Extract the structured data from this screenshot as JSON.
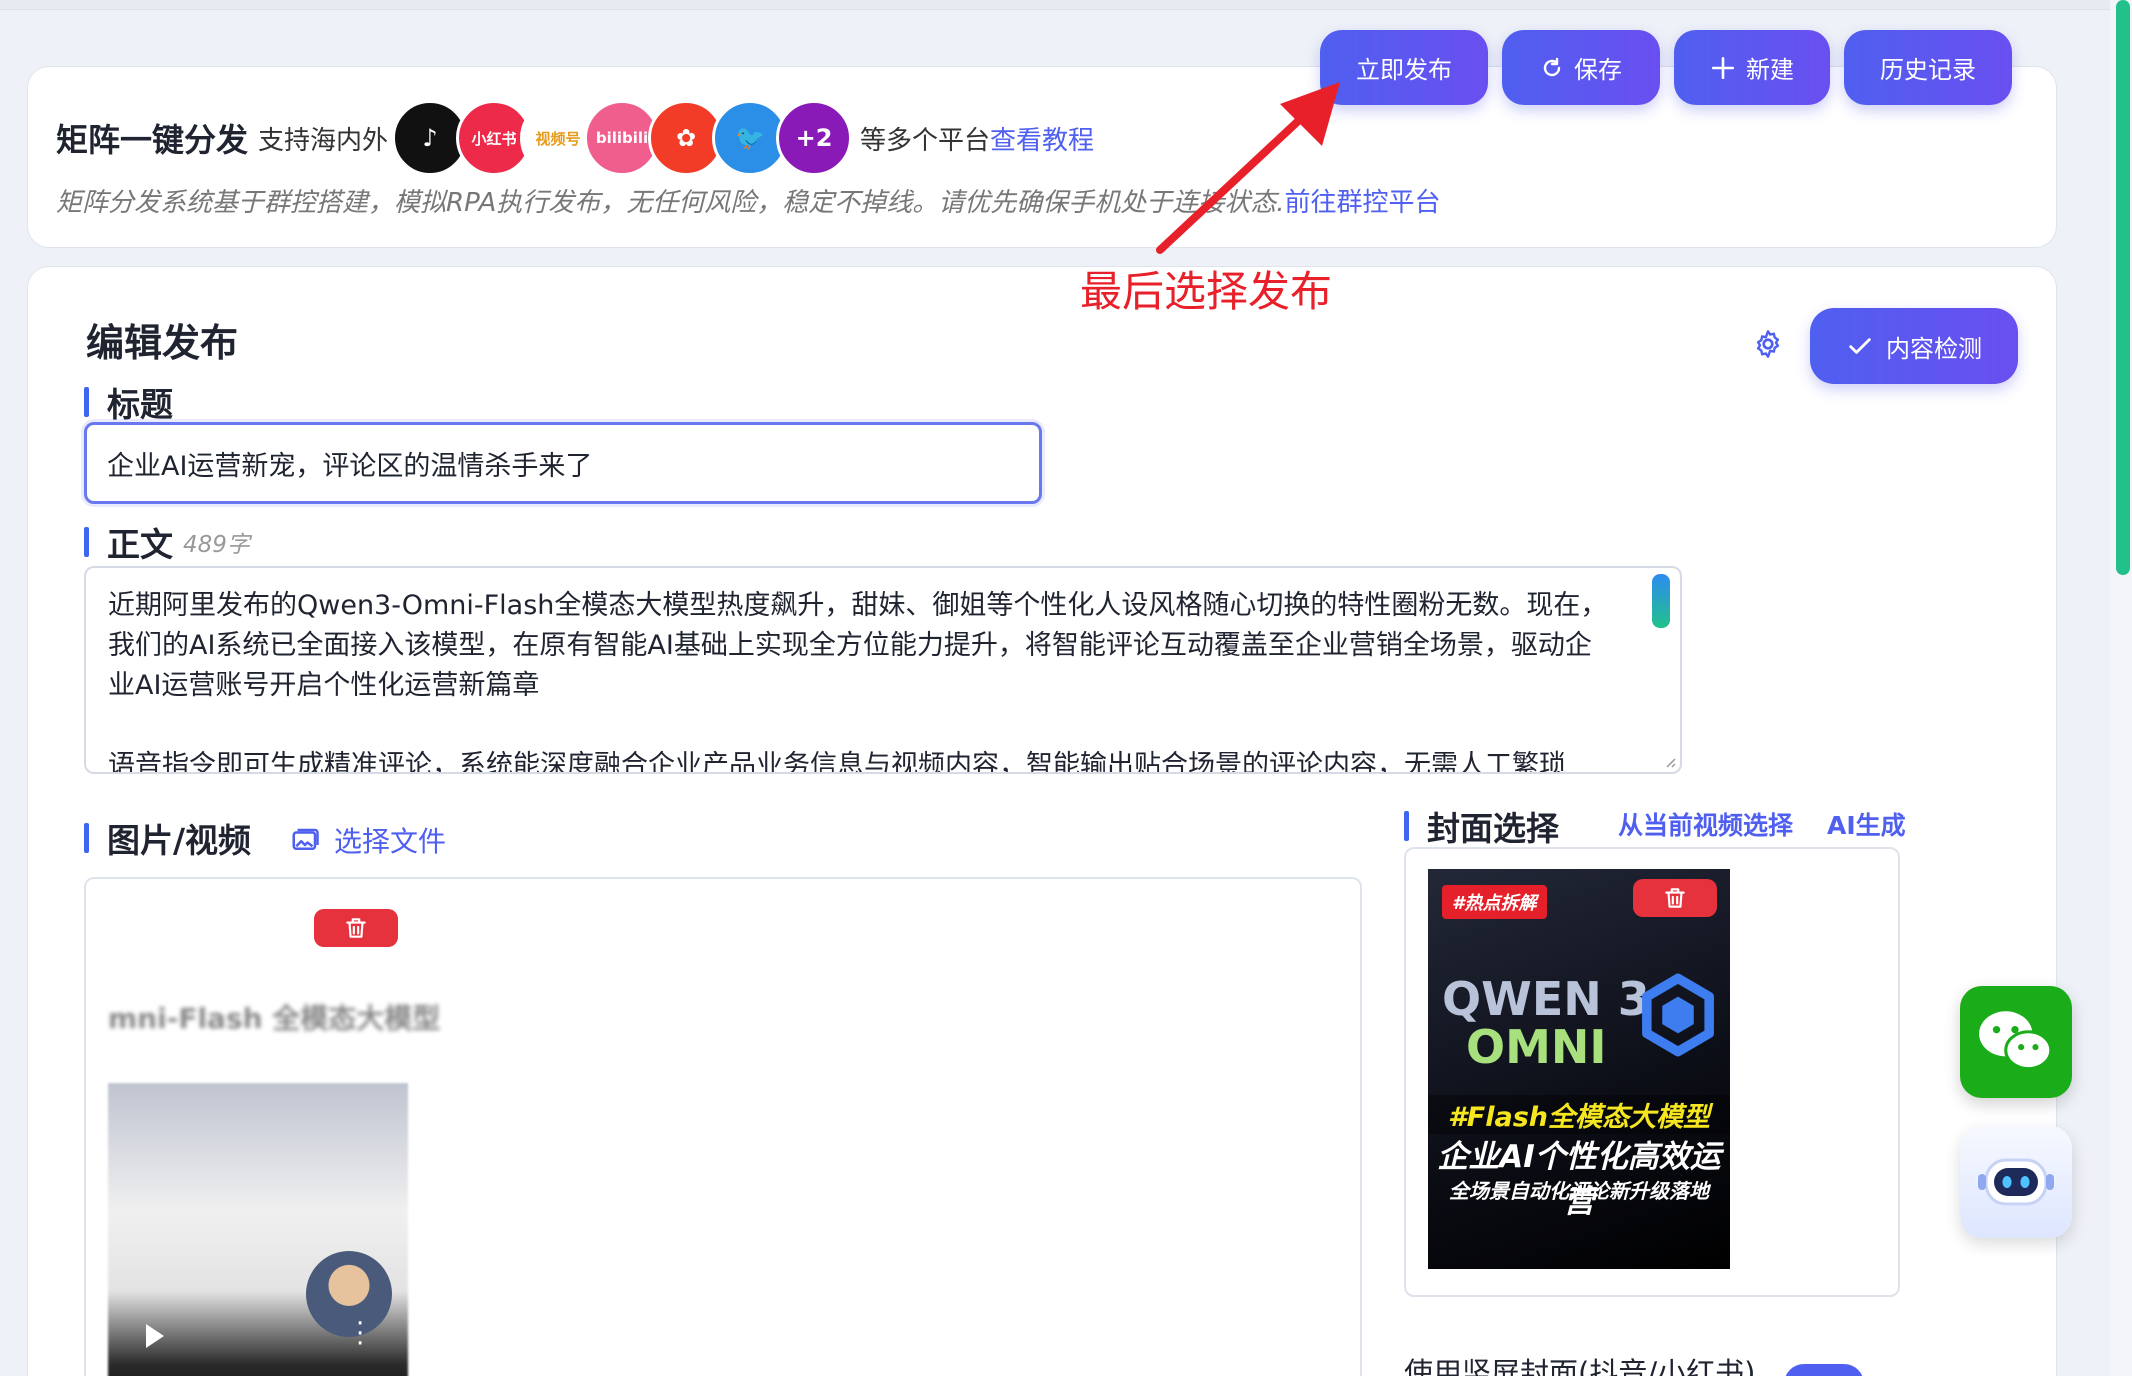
{
  "toolbar": {
    "publish": "立即发布",
    "save": "保存",
    "new": "新建",
    "history": "历史记录"
  },
  "matrix": {
    "title": "矩阵一键分发",
    "subtitle": "支持海内外",
    "platforms": [
      {
        "label": "♪",
        "color": "#111111",
        "icon": "douyin-icon"
      },
      {
        "label": "小红书",
        "color": "#ee2a4a",
        "icon": "xiaohongshu-icon"
      },
      {
        "label": "视频号",
        "color": "#ffffff",
        "icon": "shipinhao-icon"
      },
      {
        "label": "bilibili",
        "color": "#ef5e8d",
        "icon": "bilibili-icon"
      },
      {
        "label": "✿",
        "color": "#f23c28",
        "icon": "kuaishou-icon"
      },
      {
        "label": "🐦",
        "color": "#2b8fe8",
        "icon": "twitter-icon"
      },
      {
        "label": "+2",
        "color": "#8a1ab8",
        "icon": "more-platforms-icon"
      }
    ],
    "more_text": "等多个平台",
    "tutorial_link": "查看教程",
    "description": "矩阵分发系统基于群控搭建，模拟RPA执行发布，无任何风险，稳定不掉线。请优先确保手机处于连接状态.",
    "group_control_link": "前往群控平台"
  },
  "annotation": {
    "text": "最后选择发布"
  },
  "editor": {
    "heading": "编辑发布",
    "check_button": "内容检测",
    "title_label": "标题",
    "title_value": "企业AI运营新宠，评论区的温情杀手来了",
    "body_label": "正文",
    "word_count": "489字",
    "body_text": "近期阿里发布的Qwen3-Omni-Flash全模态大模型热度飙升，甜妹、御姐等个性化人设风格随心切换的特性圈粉无数。现在，我们的AI系统已全面接入该模型，在原有智能AI基础上实现全方位能力提升，将智能评论互动覆盖至企业营销全场景，驱动企业AI运营账号开启个性化运营新篇章\n\n语音指令即可生成精准评论，系统能深度融合企业产品业务信息与视频内容，智能输出贴合场景的评论内容，无需人工繁琐"
  },
  "media": {
    "label": "图片/视频",
    "choose_file": "选择文件",
    "thumb_title": "mni-Flash 全模态大模型"
  },
  "cover": {
    "label": "封面选择",
    "from_video": "从当前视频选择",
    "ai_generate": "AI生成",
    "tag": "#热点拆解",
    "line_qwen": "QWEN 3",
    "line_omni": "OMNI",
    "line1": "#Flash全模态大模型",
    "line2": "企业AI个性化高效运营",
    "line3": "全场景自动化评论新升级落地",
    "vertical_label": "使用竖屏封面(抖音/小红书)"
  },
  "colors": {
    "accent": "#4f5ff0",
    "danger": "#e6323c",
    "annotation": "#e8202a",
    "wechat": "#1aad19"
  }
}
